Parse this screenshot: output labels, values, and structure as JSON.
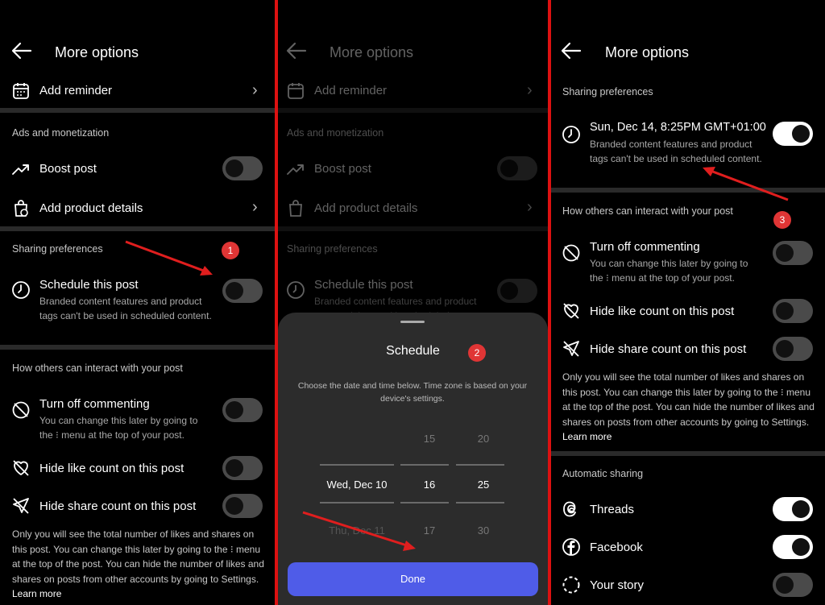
{
  "header": {
    "title": "More options"
  },
  "add_reminder": "Add reminder",
  "ads_section": "Ads and monetization",
  "boost_post": "Boost post",
  "add_product_details": "Add product details",
  "sharing_preferences": "Sharing preferences",
  "schedule_post": "Schedule this post",
  "schedule_sub": "Branded content features and product tags can't be used in scheduled content.",
  "interact_section": "How others can interact with your post",
  "turn_off_commenting": "Turn off commenting",
  "commenting_sub": "You can change this later by going to the ⁝ menu at the top of your post.",
  "hide_like_count": "Hide like count on this post",
  "hide_share_count": "Hide share count on this post",
  "visibility_note": "Only you will see the total number of likes and shares on this post. You can change this later by going to the ⁝ menu at the top of the post. You can hide the number of likes and shares on posts from other accounts by going to Settings.",
  "learn_more": "Learn more",
  "schedule_sheet": {
    "title": "Schedule",
    "hint": "Choose the date and time below. Time zone is based on your device's settings.",
    "dates": [
      "",
      "Wed, Dec 10",
      "Thu, Dec 11"
    ],
    "hours": [
      "15",
      "16",
      "17"
    ],
    "minutes": [
      "20",
      "25",
      "30"
    ],
    "done": "Done"
  },
  "scheduled_time": "Sun, Dec 14, 8:25PM GMT+01:00",
  "automatic_sharing": "Automatic sharing",
  "threads": "Threads",
  "facebook": "Facebook",
  "your_story": "Your story",
  "badges": [
    "1",
    "2",
    "3"
  ],
  "colors": {
    "accent": "#4f5ce8",
    "badge": "#e03535",
    "border": "#dd1111"
  }
}
